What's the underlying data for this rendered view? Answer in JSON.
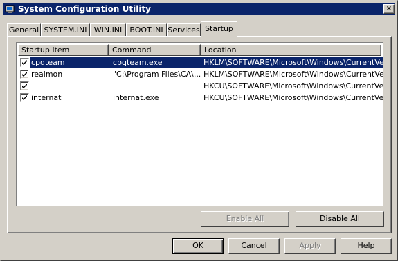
{
  "window": {
    "title": "System Configuration Utility",
    "close_label": "×"
  },
  "tabs": [
    {
      "label": "General"
    },
    {
      "label": "SYSTEM.INI"
    },
    {
      "label": "WIN.INI"
    },
    {
      "label": "BOOT.INI"
    },
    {
      "label": "Services"
    },
    {
      "label": "Startup",
      "active": true
    }
  ],
  "startup_list": {
    "columns": [
      "Startup Item",
      "Command",
      "Location"
    ],
    "rows": [
      {
        "checked": true,
        "item": "cpqteam",
        "command": "cpqteam.exe",
        "location": "HKLM\\SOFTWARE\\Microsoft\\Windows\\CurrentVer...",
        "selected": true
      },
      {
        "checked": true,
        "item": "realmon",
        "command": "\"C:\\Program Files\\CA\\...",
        "location": "HKLM\\SOFTWARE\\Microsoft\\Windows\\CurrentVer..."
      },
      {
        "checked": true,
        "item": "",
        "command": "",
        "location": "HKCU\\SOFTWARE\\Microsoft\\Windows\\CurrentVer..."
      },
      {
        "checked": true,
        "item": "internat",
        "command": "internat.exe",
        "location": "HKCU\\SOFTWARE\\Microsoft\\Windows\\CurrentVer..."
      }
    ]
  },
  "panel_buttons": {
    "enable_all": {
      "label": "Enable All",
      "enabled": false
    },
    "disable_all": {
      "label": "Disable All",
      "enabled": true
    }
  },
  "dialog_buttons": {
    "ok": "OK",
    "cancel": "Cancel",
    "apply": {
      "label": "Apply",
      "enabled": false
    },
    "help": "Help"
  },
  "colors": {
    "title_bar": "#0a246a",
    "face": "#d4d0c8",
    "selection": "#0a246a"
  },
  "icons": {
    "title_icon": "msconfig-icon",
    "checkbox_mark": "checkmark-icon"
  }
}
